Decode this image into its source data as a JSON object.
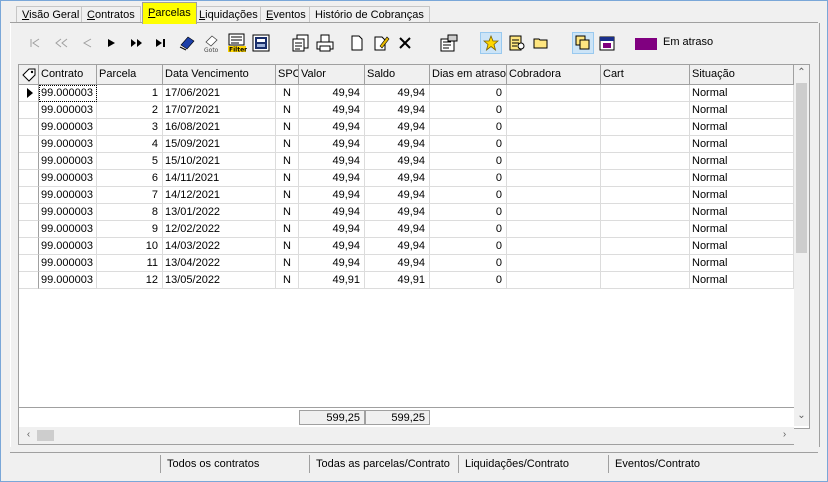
{
  "tabs": [
    {
      "pre": "",
      "u": "V",
      "post": "isão Geral"
    },
    {
      "pre": "",
      "u": "C",
      "post": "ontratos"
    },
    {
      "pre": "",
      "u": "P",
      "post": "arcelas"
    },
    {
      "pre": "",
      "u": "L",
      "post": "iquidações"
    },
    {
      "pre": "",
      "u": "E",
      "post": "ventos"
    },
    {
      "pre": "",
      "u": "",
      "post": "Histório de Cobranças"
    }
  ],
  "active_tab": "Parcelas",
  "toolbar": {
    "icons": [
      "first-disabled-icon",
      "prior-page-disabled-icon",
      "prior-disabled-icon",
      "next-icon",
      "next-page-icon",
      "last-icon",
      "bookmark-icon",
      "goto-icon",
      "filter-icon",
      "report-icon",
      "copy-icon",
      "print-icon",
      "new-document-icon",
      "edit-icon",
      "delete-icon",
      "properties-icon",
      "star-icon",
      "search-document-icon",
      "folder-icon",
      "multi-document-icon",
      "calendar-icon"
    ],
    "legend_label": "Em atraso",
    "legend_color": "#800080"
  },
  "grid": {
    "columns": [
      "Contrato",
      "Parcela",
      "Data Vencimento",
      "SPC",
      "Valor",
      "Saldo",
      "Dias em atraso",
      "Cobradora",
      "Cart",
      "Situação"
    ],
    "rows": [
      [
        "99.000003",
        "1",
        "17/06/2021",
        "N",
        "49,94",
        "49,94",
        "0",
        "",
        "",
        "Normal"
      ],
      [
        "99.000003",
        "2",
        "17/07/2021",
        "N",
        "49,94",
        "49,94",
        "0",
        "",
        "",
        "Normal"
      ],
      [
        "99.000003",
        "3",
        "16/08/2021",
        "N",
        "49,94",
        "49,94",
        "0",
        "",
        "",
        "Normal"
      ],
      [
        "99.000003",
        "4",
        "15/09/2021",
        "N",
        "49,94",
        "49,94",
        "0",
        "",
        "",
        "Normal"
      ],
      [
        "99.000003",
        "5",
        "15/10/2021",
        "N",
        "49,94",
        "49,94",
        "0",
        "",
        "",
        "Normal"
      ],
      [
        "99.000003",
        "6",
        "14/11/2021",
        "N",
        "49,94",
        "49,94",
        "0",
        "",
        "",
        "Normal"
      ],
      [
        "99.000003",
        "7",
        "14/12/2021",
        "N",
        "49,94",
        "49,94",
        "0",
        "",
        "",
        "Normal"
      ],
      [
        "99.000003",
        "8",
        "13/01/2022",
        "N",
        "49,94",
        "49,94",
        "0",
        "",
        "",
        "Normal"
      ],
      [
        "99.000003",
        "9",
        "12/02/2022",
        "N",
        "49,94",
        "49,94",
        "0",
        "",
        "",
        "Normal"
      ],
      [
        "99.000003",
        "10",
        "14/03/2022",
        "N",
        "49,94",
        "49,94",
        "0",
        "",
        "",
        "Normal"
      ],
      [
        "99.000003",
        "11",
        "13/04/2022",
        "N",
        "49,94",
        "49,94",
        "0",
        "",
        "",
        "Normal"
      ],
      [
        "99.000003",
        "12",
        "13/05/2022",
        "N",
        "49,91",
        "49,91",
        "0",
        "",
        "",
        "Normal"
      ]
    ],
    "totals": {
      "valor": "599,25",
      "saldo": "599,25"
    }
  },
  "status": [
    "",
    "Todos os contratos",
    "Todas as parcelas/Contrato",
    "Liquidações/Contrato",
    "Eventos/Contrato"
  ]
}
